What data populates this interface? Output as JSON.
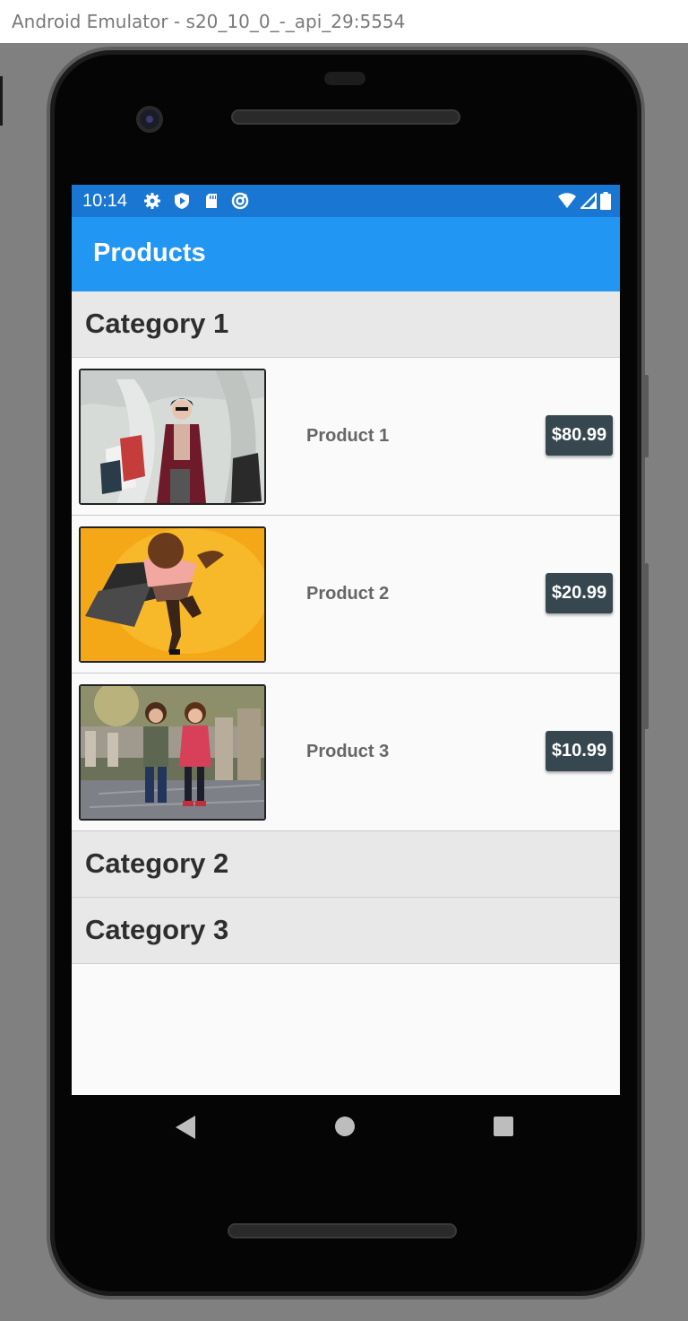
{
  "window": {
    "title": "Android Emulator - s20_10_0_-_api_29:5554"
  },
  "status_bar": {
    "time": "10:14",
    "left_icons": [
      "settings-icon",
      "shield-icon",
      "sd-card-icon",
      "sync-icon"
    ],
    "right_icons": [
      "wifi-icon",
      "signal-icon",
      "battery-icon"
    ]
  },
  "app_bar": {
    "title": "Products",
    "color": "#2196f3"
  },
  "categories": [
    {
      "label": "Category 1",
      "products": [
        {
          "name": "Product 1",
          "price": "$80.99",
          "image": "woman with shopping bags"
        },
        {
          "name": "Product 2",
          "price": "$20.99",
          "image": "dancer on yellow background"
        },
        {
          "name": "Product 3",
          "price": "$10.99",
          "image": "two children on stone path"
        }
      ]
    },
    {
      "label": "Category 2",
      "products": []
    },
    {
      "label": "Category 3",
      "products": []
    }
  ],
  "nav_bar": {
    "icons": [
      "back-icon",
      "home-icon",
      "recents-icon"
    ]
  },
  "colors": {
    "status_bar": "#1976d2",
    "price_badge": "#37474f",
    "category_bg": "#e8e8e8"
  }
}
